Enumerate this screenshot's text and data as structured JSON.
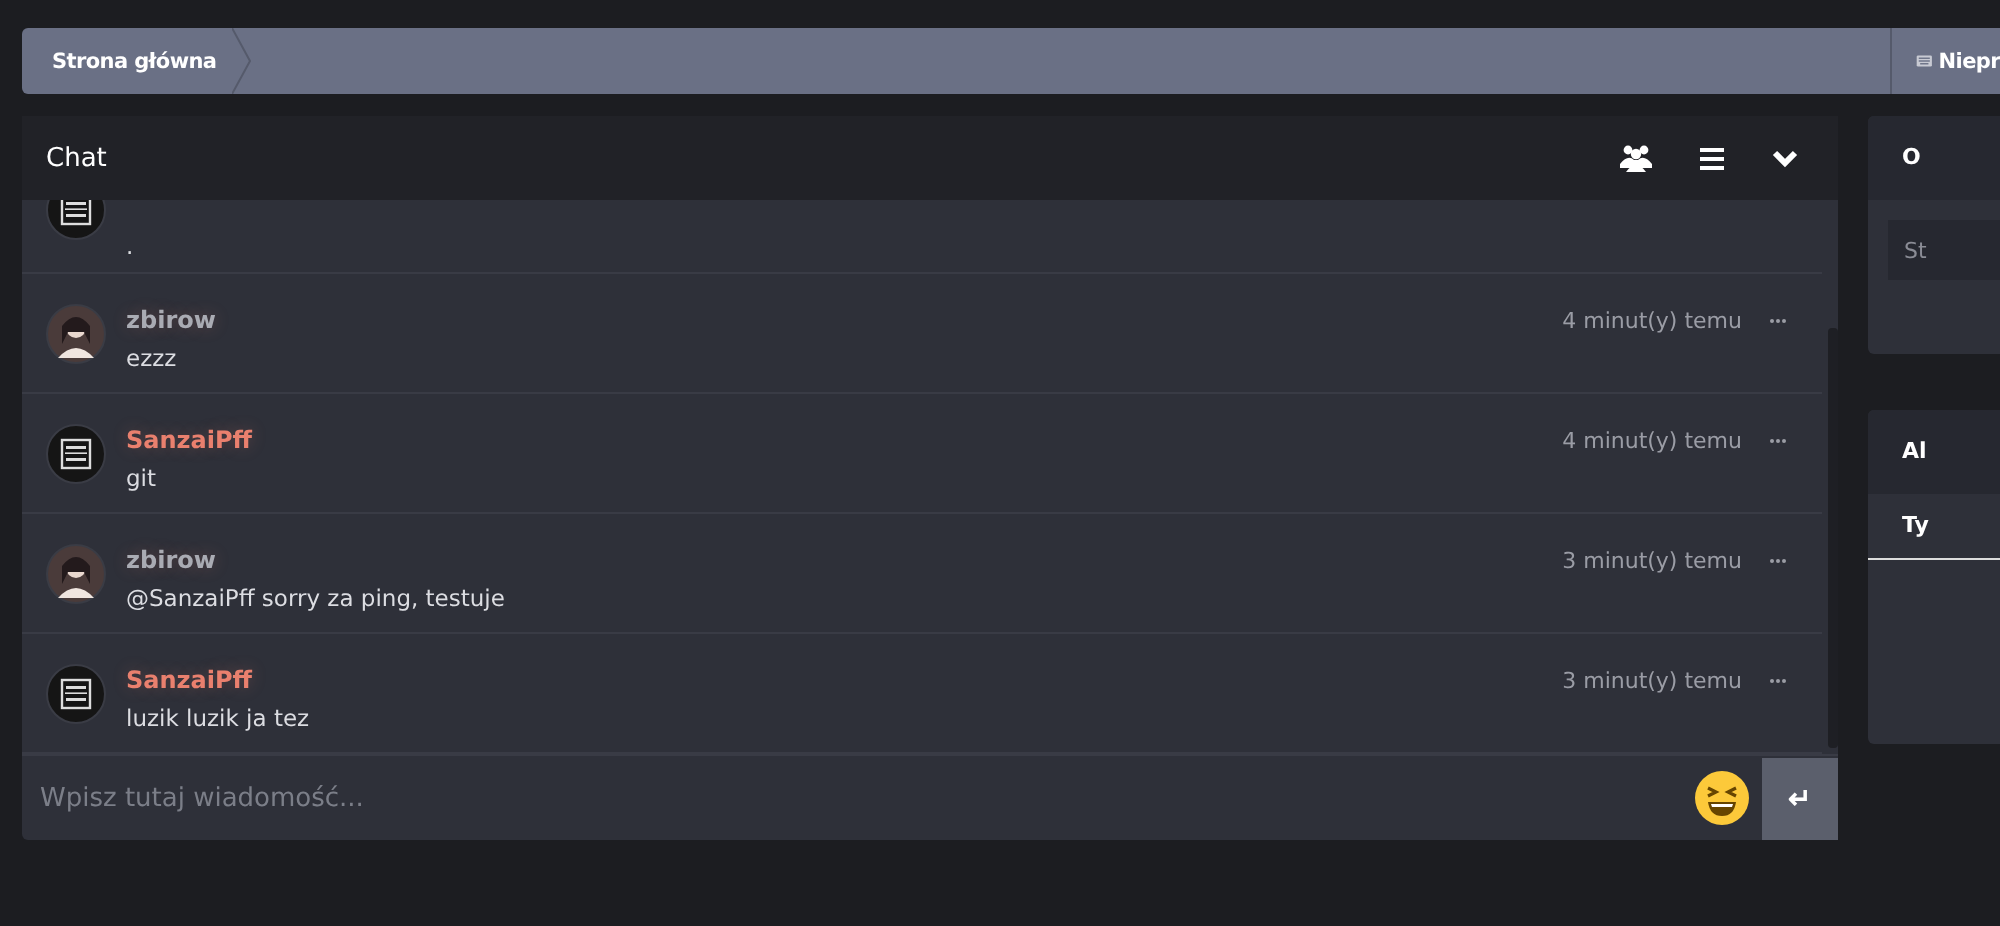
{
  "breadcrumb": {
    "items": [
      "Strona główna"
    ],
    "right_link": "Niepr"
  },
  "chat": {
    "title": "Chat",
    "messages": [
      {
        "kind": "logo",
        "text": "."
      },
      {
        "kind": "figure",
        "name": "zbirow",
        "color": "#a9abb3",
        "time": "4 minut(y) temu",
        "text": "ezzz"
      },
      {
        "kind": "logo",
        "name": "SanzaiPff",
        "color": "#e9806e",
        "time": "4 minut(y) temu",
        "text": "git"
      },
      {
        "kind": "figure",
        "name": "zbirow",
        "color": "#a9abb3",
        "time": "3 minut(y) temu",
        "text": "@SanzaiPff sorry za ping, testuje"
      },
      {
        "kind": "logo",
        "name": "SanzaiPff",
        "color": "#e9806e",
        "time": "3 minut(y) temu",
        "text": "luzik luzik ja tez"
      }
    ],
    "input": {
      "placeholder": "Wpisz tutaj wiadomość..."
    },
    "send_button": "↵"
  },
  "side_panels": [
    {
      "title": "O",
      "field_placeholder": "St"
    },
    {
      "title": "Al",
      "tab": "Ty"
    }
  ]
}
